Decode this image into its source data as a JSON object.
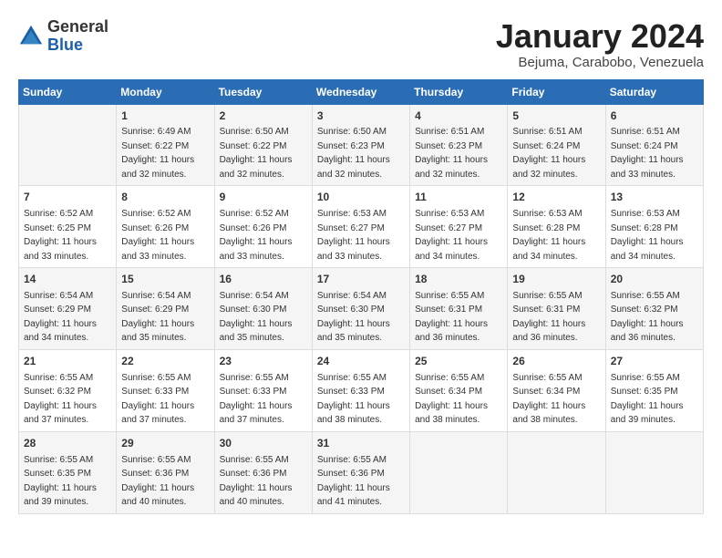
{
  "logo": {
    "general": "General",
    "blue": "Blue"
  },
  "title": "January 2024",
  "subtitle": "Bejuma, Carabobo, Venezuela",
  "days_of_week": [
    "Sunday",
    "Monday",
    "Tuesday",
    "Wednesday",
    "Thursday",
    "Friday",
    "Saturday"
  ],
  "weeks": [
    [
      {
        "day": "",
        "info": ""
      },
      {
        "day": "1",
        "info": "Sunrise: 6:49 AM\nSunset: 6:22 PM\nDaylight: 11 hours\nand 32 minutes."
      },
      {
        "day": "2",
        "info": "Sunrise: 6:50 AM\nSunset: 6:22 PM\nDaylight: 11 hours\nand 32 minutes."
      },
      {
        "day": "3",
        "info": "Sunrise: 6:50 AM\nSunset: 6:23 PM\nDaylight: 11 hours\nand 32 minutes."
      },
      {
        "day": "4",
        "info": "Sunrise: 6:51 AM\nSunset: 6:23 PM\nDaylight: 11 hours\nand 32 minutes."
      },
      {
        "day": "5",
        "info": "Sunrise: 6:51 AM\nSunset: 6:24 PM\nDaylight: 11 hours\nand 32 minutes."
      },
      {
        "day": "6",
        "info": "Sunrise: 6:51 AM\nSunset: 6:24 PM\nDaylight: 11 hours\nand 33 minutes."
      }
    ],
    [
      {
        "day": "7",
        "info": "Sunrise: 6:52 AM\nSunset: 6:25 PM\nDaylight: 11 hours\nand 33 minutes."
      },
      {
        "day": "8",
        "info": "Sunrise: 6:52 AM\nSunset: 6:26 PM\nDaylight: 11 hours\nand 33 minutes."
      },
      {
        "day": "9",
        "info": "Sunrise: 6:52 AM\nSunset: 6:26 PM\nDaylight: 11 hours\nand 33 minutes."
      },
      {
        "day": "10",
        "info": "Sunrise: 6:53 AM\nSunset: 6:27 PM\nDaylight: 11 hours\nand 33 minutes."
      },
      {
        "day": "11",
        "info": "Sunrise: 6:53 AM\nSunset: 6:27 PM\nDaylight: 11 hours\nand 34 minutes."
      },
      {
        "day": "12",
        "info": "Sunrise: 6:53 AM\nSunset: 6:28 PM\nDaylight: 11 hours\nand 34 minutes."
      },
      {
        "day": "13",
        "info": "Sunrise: 6:53 AM\nSunset: 6:28 PM\nDaylight: 11 hours\nand 34 minutes."
      }
    ],
    [
      {
        "day": "14",
        "info": "Sunrise: 6:54 AM\nSunset: 6:29 PM\nDaylight: 11 hours\nand 34 minutes."
      },
      {
        "day": "15",
        "info": "Sunrise: 6:54 AM\nSunset: 6:29 PM\nDaylight: 11 hours\nand 35 minutes."
      },
      {
        "day": "16",
        "info": "Sunrise: 6:54 AM\nSunset: 6:30 PM\nDaylight: 11 hours\nand 35 minutes."
      },
      {
        "day": "17",
        "info": "Sunrise: 6:54 AM\nSunset: 6:30 PM\nDaylight: 11 hours\nand 35 minutes."
      },
      {
        "day": "18",
        "info": "Sunrise: 6:55 AM\nSunset: 6:31 PM\nDaylight: 11 hours\nand 36 minutes."
      },
      {
        "day": "19",
        "info": "Sunrise: 6:55 AM\nSunset: 6:31 PM\nDaylight: 11 hours\nand 36 minutes."
      },
      {
        "day": "20",
        "info": "Sunrise: 6:55 AM\nSunset: 6:32 PM\nDaylight: 11 hours\nand 36 minutes."
      }
    ],
    [
      {
        "day": "21",
        "info": "Sunrise: 6:55 AM\nSunset: 6:32 PM\nDaylight: 11 hours\nand 37 minutes."
      },
      {
        "day": "22",
        "info": "Sunrise: 6:55 AM\nSunset: 6:33 PM\nDaylight: 11 hours\nand 37 minutes."
      },
      {
        "day": "23",
        "info": "Sunrise: 6:55 AM\nSunset: 6:33 PM\nDaylight: 11 hours\nand 37 minutes."
      },
      {
        "day": "24",
        "info": "Sunrise: 6:55 AM\nSunset: 6:33 PM\nDaylight: 11 hours\nand 38 minutes."
      },
      {
        "day": "25",
        "info": "Sunrise: 6:55 AM\nSunset: 6:34 PM\nDaylight: 11 hours\nand 38 minutes."
      },
      {
        "day": "26",
        "info": "Sunrise: 6:55 AM\nSunset: 6:34 PM\nDaylight: 11 hours\nand 38 minutes."
      },
      {
        "day": "27",
        "info": "Sunrise: 6:55 AM\nSunset: 6:35 PM\nDaylight: 11 hours\nand 39 minutes."
      }
    ],
    [
      {
        "day": "28",
        "info": "Sunrise: 6:55 AM\nSunset: 6:35 PM\nDaylight: 11 hours\nand 39 minutes."
      },
      {
        "day": "29",
        "info": "Sunrise: 6:55 AM\nSunset: 6:36 PM\nDaylight: 11 hours\nand 40 minutes."
      },
      {
        "day": "30",
        "info": "Sunrise: 6:55 AM\nSunset: 6:36 PM\nDaylight: 11 hours\nand 40 minutes."
      },
      {
        "day": "31",
        "info": "Sunrise: 6:55 AM\nSunset: 6:36 PM\nDaylight: 11 hours\nand 41 minutes."
      },
      {
        "day": "",
        "info": ""
      },
      {
        "day": "",
        "info": ""
      },
      {
        "day": "",
        "info": ""
      }
    ]
  ]
}
